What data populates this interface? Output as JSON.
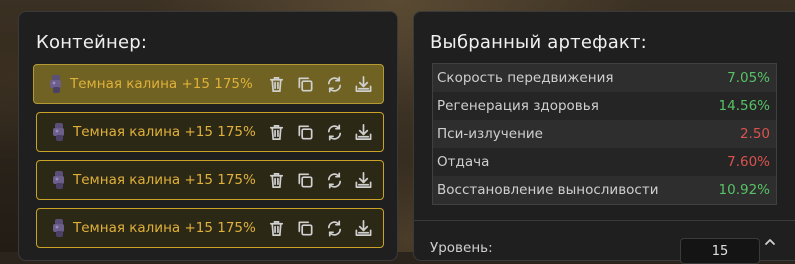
{
  "container": {
    "title": "Контейнер:",
    "items": [
      {
        "label": "Темная калина +15 175%",
        "selected": true
      },
      {
        "label": "Темная калина +15 175%",
        "selected": false
      },
      {
        "label": "Темная калина +15 175%",
        "selected": false
      },
      {
        "label": "Темная калина +15 175%",
        "selected": false
      }
    ],
    "actions": [
      "trash-icon",
      "copy-icon",
      "refresh-icon",
      "download-icon"
    ]
  },
  "artifact": {
    "title": "Выбранный артефакт:",
    "stats": [
      {
        "name": "Скорость передвижения",
        "value": "7.05%",
        "status": "positive"
      },
      {
        "name": "Регенерация здоровья",
        "value": "14.56%",
        "status": "positive"
      },
      {
        "name": "Пси-излучение",
        "value": "2.50",
        "status": "negative"
      },
      {
        "name": "Отдача",
        "value": "7.60%",
        "status": "negative"
      },
      {
        "name": "Восстановление выносливости",
        "value": "10.92%",
        "status": "positive"
      }
    ],
    "level_label": "Уровень:",
    "level_value": "15"
  },
  "colors": {
    "accent": "#e0b13a",
    "positive": "#57c266",
    "negative": "#d9534f"
  }
}
